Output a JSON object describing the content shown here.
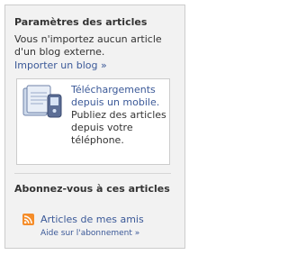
{
  "settings": {
    "title": "Paramètres des articles",
    "no_import_text": "Vous n'importez aucun article d'un blog externe.",
    "import_link": "Importer un blog »"
  },
  "mobile": {
    "icon": "mobile-phone-icon",
    "link_text": "Téléchargements depuis un mobile.",
    "body_text": " Publiez des articles depuis votre téléphone."
  },
  "subscribe": {
    "title": "Abonnez-vous à ces articles",
    "rss_icon": "rss-feed-icon",
    "feed_link": "Articles de mes amis",
    "help_link": "Aide sur l'abonnement »"
  },
  "colors": {
    "link": "#3b5998",
    "rss": "#f58d2a",
    "panel_bg": "#f2f2f2"
  }
}
